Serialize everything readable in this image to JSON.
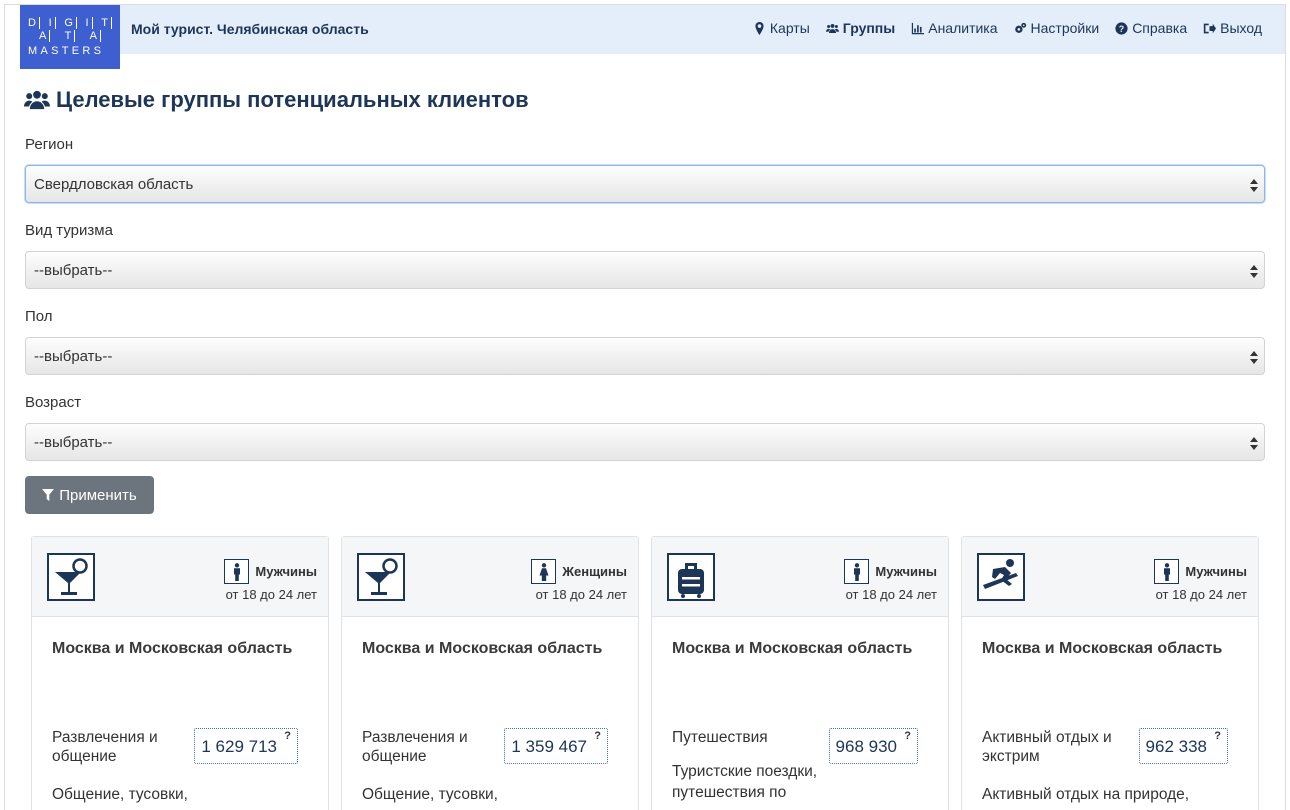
{
  "logo": {
    "row1": [
      "D",
      "I",
      "G",
      "I",
      "T"
    ],
    "row2": [
      "A",
      "T",
      "A"
    ],
    "row3": "MASTERS"
  },
  "brand": "Мой турист. Челябинская область",
  "nav": [
    {
      "label": "Карты",
      "icon": "map-marker-icon"
    },
    {
      "label": "Группы",
      "icon": "users-icon",
      "active": true
    },
    {
      "label": "Аналитика",
      "icon": "bar-chart-icon"
    },
    {
      "label": "Настройки",
      "icon": "gears-icon"
    },
    {
      "label": "Справка",
      "icon": "question-circle-icon"
    },
    {
      "label": "Выход",
      "icon": "sign-out-icon"
    }
  ],
  "page_title": "Целевые группы потенциальных клиентов",
  "filters": {
    "region": {
      "label": "Регион",
      "value": "Свердловская область"
    },
    "tourism": {
      "label": "Вид туризма",
      "value": "--выбрать--"
    },
    "gender": {
      "label": "Пол",
      "value": "--выбрать--"
    },
    "age": {
      "label": "Возраст",
      "value": "--выбрать--"
    }
  },
  "apply_label": "Применить",
  "cards": [
    {
      "icon": "cocktail-icon",
      "gender": "Мужчины",
      "age": "от 18 до 24 лет",
      "region": "Москва и Московская область",
      "category": "Развлечения и общение",
      "count": "1 629 713",
      "q": "?",
      "desc": "Общение, тусовки, знакомства,"
    },
    {
      "icon": "cocktail-icon",
      "gender": "Женщины",
      "age": "от 18 до 24 лет",
      "region": "Москва и Московская область",
      "category": "Развлечения и общение",
      "count": "1 359 467",
      "q": "?",
      "desc": "Общение, тусовки, знакомства,"
    },
    {
      "icon": "suitcase-icon",
      "gender": "Мужчины",
      "age": "от 18 до 24 лет",
      "region": "Москва и Московская область",
      "category": "Путешествия",
      "count": "968 930",
      "q": "?",
      "desc": "Туристские поездки, путешествия по"
    },
    {
      "icon": "snowboard-icon",
      "gender": "Мужчины",
      "age": "от 18 до 24 лет",
      "region": "Москва и Московская область",
      "category": "Активный отдых и экстрим",
      "count": "962 338",
      "q": "?",
      "desc": "Активный отдых на природе,"
    }
  ],
  "colors": {
    "navbar": "#e3eefa",
    "logo": "#3e5fd0",
    "primary_text": "#1d3557",
    "apply_button": "#6c757d"
  }
}
